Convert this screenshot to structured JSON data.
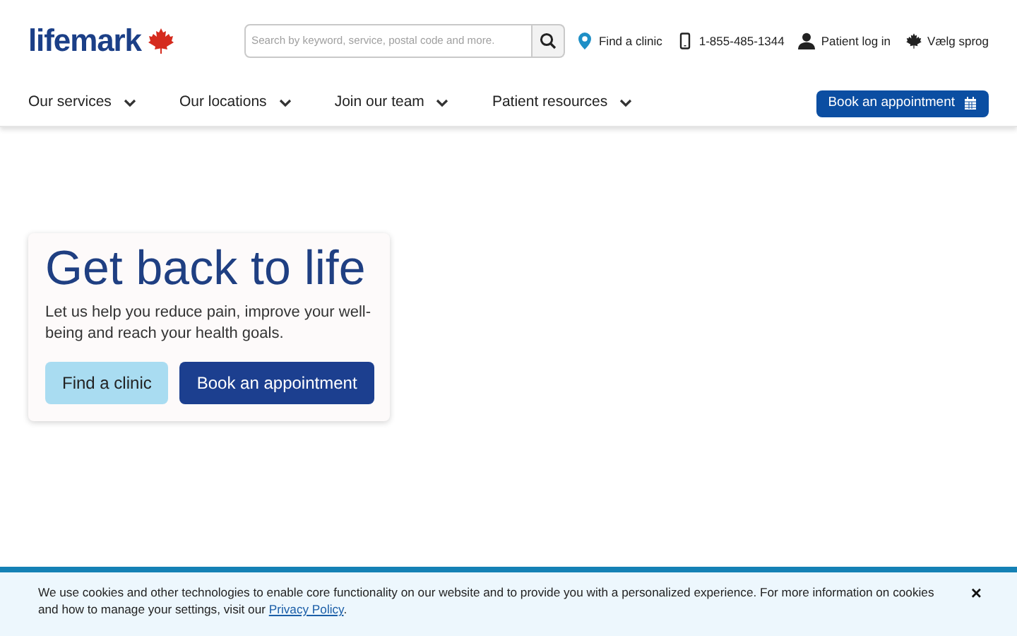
{
  "header": {
    "logo": "lifemark",
    "search": {
      "placeholder": "Search by keyword, service, postal code and more."
    },
    "utility_links": [
      {
        "kind": "pin",
        "label": "Find a clinic"
      },
      {
        "kind": "phone",
        "label": "1-855-485-1344"
      },
      {
        "kind": "person",
        "label": "Patient log in"
      },
      {
        "kind": "leaf",
        "label": "Vælg sprog"
      }
    ],
    "nav": [
      {
        "label": "Our services"
      },
      {
        "label": "Our locations"
      },
      {
        "label": "Join our team"
      },
      {
        "label": "Patient resources"
      }
    ],
    "book_button": "Book an appointment"
  },
  "hero": {
    "title": "Get back to life",
    "text": "Let us help you reduce pain, improve your well-being and reach your health goals.",
    "buttons": [
      {
        "kind": "secondary",
        "label": "Find a clinic"
      },
      {
        "kind": "primary",
        "label": "Book an appointment"
      }
    ]
  },
  "cookie_banner": {
    "text_before": "We use cookies and other technologies to enable core functionality on our website and to provide you with a personalized experience. For more information on cookies and how to manage your settings, visit our ",
    "link": "Privacy Policy",
    "text_after": ".",
    "close": "×"
  }
}
